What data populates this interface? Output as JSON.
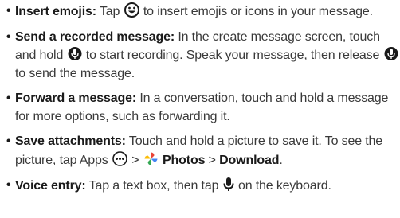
{
  "items": [
    {
      "title": "Insert emojis:",
      "text_a": " Tap ",
      "icon": "smiley-icon",
      "text_b": " to insert emojis or icons in your message."
    },
    {
      "title": "Send a recorded message:",
      "text_a": " In the create message screen, touch and hold ",
      "icon": "microphone-icon",
      "text_b": " to start recording. Speak your message, then release ",
      "icon2": "microphone-icon",
      "text_c": " to send the message."
    },
    {
      "title": "Forward a message:",
      "text_a": " In a conversation, touch and hold a message for more options, such as forwarding it."
    },
    {
      "title": "Save attachments:",
      "text_a": " Touch and hold a picture to save it. To see the picture, tap Apps ",
      "icon": "apps-icon",
      "text_b": " > ",
      "icon2": "photos-pinwheel-icon",
      "photos_label": "Photos",
      "sep": " > ",
      "download_label": "Download",
      "end": "."
    },
    {
      "title": "Voice entry:",
      "text_a": " Tap a text box, then tap ",
      "icon": "microphone-icon",
      "text_b": " on the keyboard."
    }
  ],
  "bullet": "•"
}
